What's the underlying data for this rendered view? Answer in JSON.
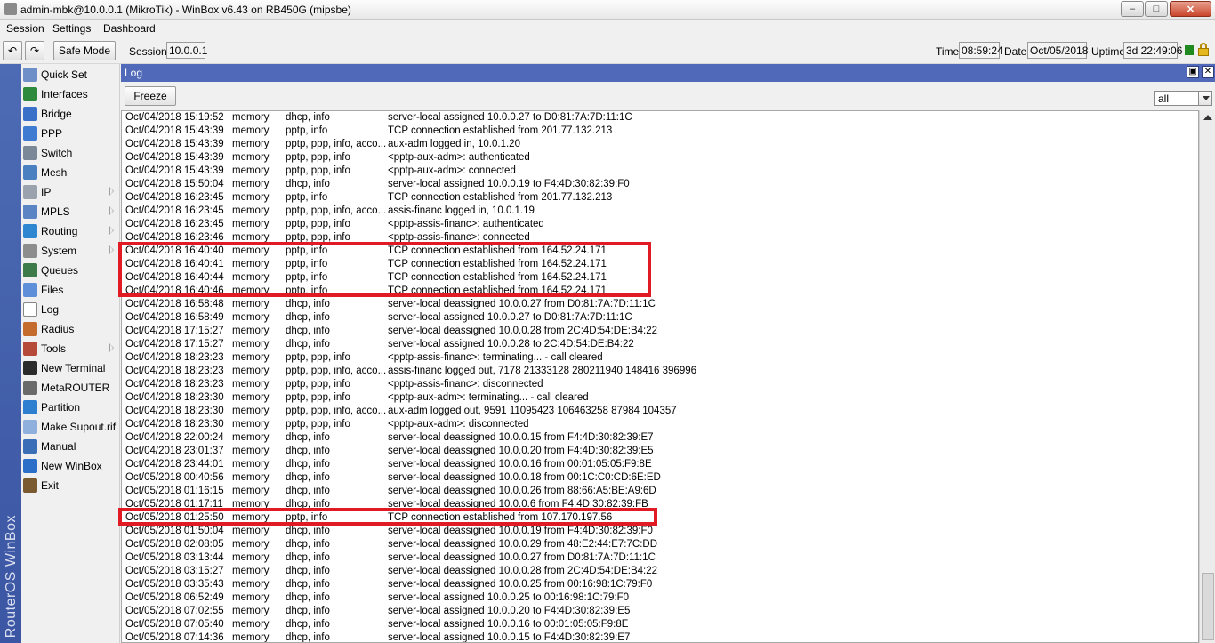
{
  "window": {
    "title": "admin-mbk@10.0.0.1 (MikroTik) - WinBox v6.43 on RB450G (mipsbe)",
    "minimize": "–",
    "maximize": "□",
    "close": "✕"
  },
  "menubar": {
    "items": [
      "Session",
      "Settings",
      "Dashboard"
    ]
  },
  "toolbar": {
    "undo": "↶",
    "redo": "↷",
    "safe_mode": "Safe Mode",
    "session_label": "Session:",
    "session_value": "10.0.0.1",
    "time_label": "Time:",
    "time_value": "08:59:24",
    "date_label": "Date:",
    "date_value": "Oct/05/2018",
    "uptime_label": "Uptime:",
    "uptime_value": "3d 22:49:06",
    "status_color": "#1f8a1f"
  },
  "brand": "RouterOS WinBox",
  "sidebar": {
    "items": [
      {
        "label": "Quick Set",
        "icon": "quick-set-icon",
        "color": "#6f8fc9",
        "submenu": false
      },
      {
        "label": "Interfaces",
        "icon": "interfaces-icon",
        "color": "#2e8b3e",
        "submenu": false
      },
      {
        "label": "Bridge",
        "icon": "bridge-icon",
        "color": "#3a70c8",
        "submenu": false
      },
      {
        "label": "PPP",
        "icon": "ppp-icon",
        "color": "#3f7bd1",
        "submenu": false
      },
      {
        "label": "Switch",
        "icon": "switch-icon",
        "color": "#7b8898",
        "submenu": false
      },
      {
        "label": "Mesh",
        "icon": "mesh-icon",
        "color": "#4a7fc0",
        "submenu": false
      },
      {
        "label": "IP",
        "icon": "ip-icon",
        "color": "#9aa2ad",
        "submenu": true
      },
      {
        "label": "MPLS",
        "icon": "mpls-icon",
        "color": "#5a84c4",
        "submenu": true
      },
      {
        "label": "Routing",
        "icon": "routing-icon",
        "color": "#2f86d1",
        "submenu": true
      },
      {
        "label": "System",
        "icon": "system-icon",
        "color": "#8d8d8d",
        "submenu": true
      },
      {
        "label": "Queues",
        "icon": "queues-icon",
        "color": "#3d7b4a",
        "submenu": false
      },
      {
        "label": "Files",
        "icon": "files-icon",
        "color": "#5e8fd8",
        "submenu": false
      },
      {
        "label": "Log",
        "icon": "log-icon",
        "color": "#ffffff",
        "submenu": false
      },
      {
        "label": "Radius",
        "icon": "radius-icon",
        "color": "#c46b2e",
        "submenu": false
      },
      {
        "label": "Tools",
        "icon": "tools-icon",
        "color": "#b54a3a",
        "submenu": true
      },
      {
        "label": "New Terminal",
        "icon": "terminal-icon",
        "color": "#2b2b2b",
        "submenu": false
      },
      {
        "label": "MetaROUTER",
        "icon": "metarouter-icon",
        "color": "#6a6a6a",
        "submenu": false
      },
      {
        "label": "Partition",
        "icon": "partition-icon",
        "color": "#2f7fd1",
        "submenu": false
      },
      {
        "label": "Make Supout.rif",
        "icon": "supout-icon",
        "color": "#8fb0dd",
        "submenu": false
      },
      {
        "label": "Manual",
        "icon": "manual-icon",
        "color": "#3a6fb8",
        "submenu": false
      },
      {
        "label": "New WinBox",
        "icon": "winbox-icon",
        "color": "#2b6fc9",
        "submenu": false
      },
      {
        "label": "Exit",
        "icon": "exit-icon",
        "color": "#7a5a30",
        "submenu": false
      }
    ]
  },
  "log": {
    "title": "Log",
    "freeze": "Freeze",
    "filter": "all",
    "restore": "▣",
    "close": "✕",
    "rows": [
      [
        "Oct/04/2018 15:19:52",
        "memory",
        "dhcp, info",
        "server-local assigned 10.0.0.27 to D0:81:7A:7D:11:1C"
      ],
      [
        "Oct/04/2018 15:43:39",
        "memory",
        "pptp, info",
        "TCP connection established from 201.77.132.213"
      ],
      [
        "Oct/04/2018 15:43:39",
        "memory",
        "pptp, ppp, info, acco...",
        "aux-adm logged in, 10.0.1.20"
      ],
      [
        "Oct/04/2018 15:43:39",
        "memory",
        "pptp, ppp, info",
        "<pptp-aux-adm>: authenticated"
      ],
      [
        "Oct/04/2018 15:43:39",
        "memory",
        "pptp, ppp, info",
        "<pptp-aux-adm>: connected"
      ],
      [
        "Oct/04/2018 15:50:04",
        "memory",
        "dhcp, info",
        "server-local assigned 10.0.0.19 to F4:4D:30:82:39:F0"
      ],
      [
        "Oct/04/2018 16:23:45",
        "memory",
        "pptp, info",
        "TCP connection established from 201.77.132.213"
      ],
      [
        "Oct/04/2018 16:23:45",
        "memory",
        "pptp, ppp, info, acco...",
        "assis-financ logged in, 10.0.1.19"
      ],
      [
        "Oct/04/2018 16:23:45",
        "memory",
        "pptp, ppp, info",
        "<pptp-assis-financ>: authenticated"
      ],
      [
        "Oct/04/2018 16:23:46",
        "memory",
        "pptp, ppp, info",
        "<pptp-assis-financ>: connected"
      ],
      [
        "Oct/04/2018 16:40:40",
        "memory",
        "pptp, info",
        "TCP connection established from 164.52.24.171"
      ],
      [
        "Oct/04/2018 16:40:41",
        "memory",
        "pptp, info",
        "TCP connection established from 164.52.24.171"
      ],
      [
        "Oct/04/2018 16:40:44",
        "memory",
        "pptp, info",
        "TCP connection established from 164.52.24.171"
      ],
      [
        "Oct/04/2018 16:40:46",
        "memory",
        "pptp, info",
        "TCP connection established from 164.52.24.171"
      ],
      [
        "Oct/04/2018 16:58:48",
        "memory",
        "dhcp, info",
        "server-local deassigned 10.0.0.27 from D0:81:7A:7D:11:1C"
      ],
      [
        "Oct/04/2018 16:58:49",
        "memory",
        "dhcp, info",
        "server-local assigned 10.0.0.27 to D0:81:7A:7D:11:1C"
      ],
      [
        "Oct/04/2018 17:15:27",
        "memory",
        "dhcp, info",
        "server-local deassigned 10.0.0.28 from 2C:4D:54:DE:B4:22"
      ],
      [
        "Oct/04/2018 17:15:27",
        "memory",
        "dhcp, info",
        "server-local assigned 10.0.0.28 to 2C:4D:54:DE:B4:22"
      ],
      [
        "Oct/04/2018 18:23:23",
        "memory",
        "pptp, ppp, info",
        "<pptp-assis-financ>: terminating... - call cleared"
      ],
      [
        "Oct/04/2018 18:23:23",
        "memory",
        "pptp, ppp, info, acco...",
        "assis-financ logged out, 7178 21333128 280211940 148416 396996"
      ],
      [
        "Oct/04/2018 18:23:23",
        "memory",
        "pptp, ppp, info",
        "<pptp-assis-financ>: disconnected"
      ],
      [
        "Oct/04/2018 18:23:30",
        "memory",
        "pptp, ppp, info",
        "<pptp-aux-adm>: terminating... - call cleared"
      ],
      [
        "Oct/04/2018 18:23:30",
        "memory",
        "pptp, ppp, info, acco...",
        "aux-adm logged out, 9591 11095423 106463258 87984 104357"
      ],
      [
        "Oct/04/2018 18:23:30",
        "memory",
        "pptp, ppp, info",
        "<pptp-aux-adm>: disconnected"
      ],
      [
        "Oct/04/2018 22:00:24",
        "memory",
        "dhcp, info",
        "server-local deassigned 10.0.0.15 from F4:4D:30:82:39:E7"
      ],
      [
        "Oct/04/2018 23:01:37",
        "memory",
        "dhcp, info",
        "server-local deassigned 10.0.0.20 from F4:4D:30:82:39:E5"
      ],
      [
        "Oct/04/2018 23:44:01",
        "memory",
        "dhcp, info",
        "server-local deassigned 10.0.0.16 from 00:01:05:05:F9:8E"
      ],
      [
        "Oct/05/2018 00:40:56",
        "memory",
        "dhcp, info",
        "server-local deassigned 10.0.0.18 from 00:1C:C0:CD:6E:ED"
      ],
      [
        "Oct/05/2018 01:16:15",
        "memory",
        "dhcp, info",
        "server-local deassigned 10.0.0.26 from 88:66:A5:BE:A9:6D"
      ],
      [
        "Oct/05/2018 01:17:11",
        "memory",
        "dhcp, info",
        "server-local deassigned 10.0.0.6 from F4:4D:30:82:39:FB"
      ],
      [
        "Oct/05/2018 01:25:50",
        "memory",
        "pptp, info",
        "TCP connection established from 107.170.197.56"
      ],
      [
        "Oct/05/2018 01:50:04",
        "memory",
        "dhcp, info",
        "server-local deassigned 10.0.0.19 from F4:4D:30:82:39:F0"
      ],
      [
        "Oct/05/2018 02:08:05",
        "memory",
        "dhcp, info",
        "server-local deassigned 10.0.0.29 from 48:E2:44:E7:7C:DD"
      ],
      [
        "Oct/05/2018 03:13:44",
        "memory",
        "dhcp, info",
        "server-local deassigned 10.0.0.27 from D0:81:7A:7D:11:1C"
      ],
      [
        "Oct/05/2018 03:15:27",
        "memory",
        "dhcp, info",
        "server-local deassigned 10.0.0.28 from 2C:4D:54:DE:B4:22"
      ],
      [
        "Oct/05/2018 03:35:43",
        "memory",
        "dhcp, info",
        "server-local deassigned 10.0.0.25 from 00:16:98:1C:79:F0"
      ],
      [
        "Oct/05/2018 06:52:49",
        "memory",
        "dhcp, info",
        "server-local assigned 10.0.0.25 to 00:16:98:1C:79:F0"
      ],
      [
        "Oct/05/2018 07:02:55",
        "memory",
        "dhcp, info",
        "server-local assigned 10.0.0.20 to F4:4D:30:82:39:E5"
      ],
      [
        "Oct/05/2018 07:05:40",
        "memory",
        "dhcp, info",
        "server-local assigned 10.0.0.16 to 00:01:05:05:F9:8E"
      ],
      [
        "Oct/05/2018 07:14:36",
        "memory",
        "dhcp, info",
        "server-local assigned 10.0.0.15 to F4:4D:30:82:39:E7"
      ]
    ]
  },
  "highlight_color": "#e01b24"
}
